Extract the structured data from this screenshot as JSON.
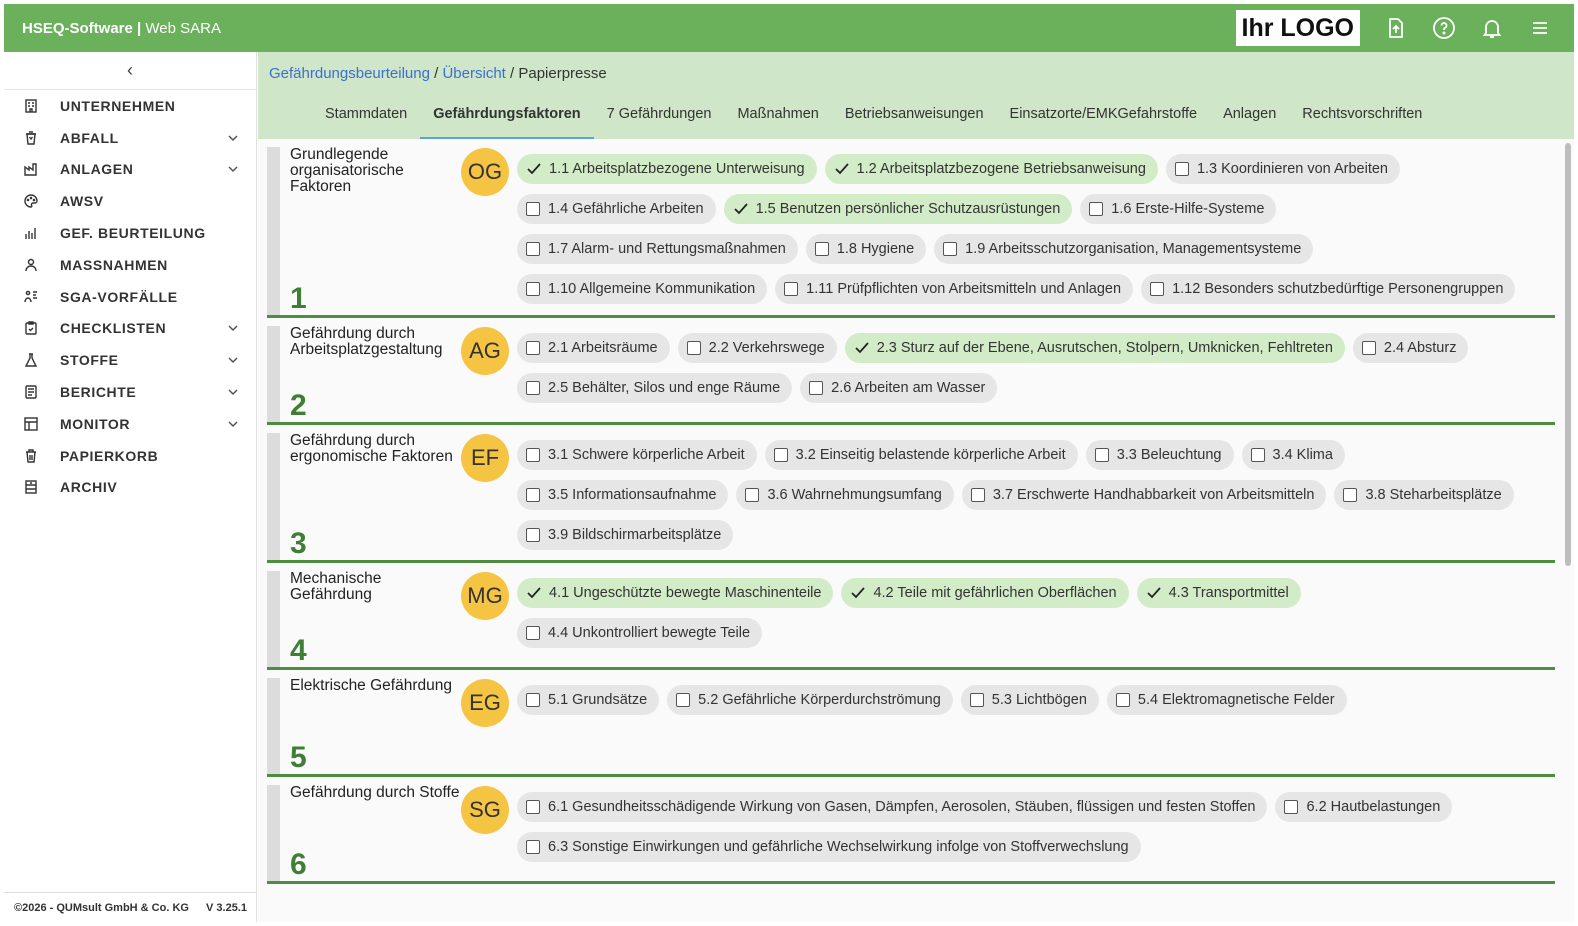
{
  "app": {
    "brand_bold": "HSEQ-Software |",
    "brand_light": " Web SARA",
    "logo_text": "Ihr LOGO"
  },
  "sidebar": {
    "collapse_icon": "chevron-left-icon",
    "items": [
      {
        "label": "UNTERNEHMEN",
        "icon": "building-icon",
        "expandable": false
      },
      {
        "label": "ABFALL",
        "icon": "recycle-icon",
        "expandable": true
      },
      {
        "label": "ANLAGEN",
        "icon": "factory-icon",
        "expandable": true
      },
      {
        "label": "AWSV",
        "icon": "palette-icon",
        "expandable": false
      },
      {
        "label": "GEF. BEURTEILUNG",
        "icon": "chart-icon",
        "expandable": false
      },
      {
        "label": "MASSNAHMEN",
        "icon": "people-icon",
        "expandable": false
      },
      {
        "label": "SGA-VORFÄLLE",
        "icon": "incident-icon",
        "expandable": false
      },
      {
        "label": "CHECKLISTEN",
        "icon": "clipboard-icon",
        "expandable": true
      },
      {
        "label": "STOFFE",
        "icon": "flask-icon",
        "expandable": true
      },
      {
        "label": "BERICHTE",
        "icon": "report-icon",
        "expandable": true
      },
      {
        "label": "MONITOR",
        "icon": "monitor-icon",
        "expandable": true
      },
      {
        "label": "PAPIERKORB",
        "icon": "trash-icon",
        "expandable": false
      },
      {
        "label": "ARCHIV",
        "icon": "archive-icon",
        "expandable": false
      }
    ],
    "footer_copyright": "©2026 - QUMsult GmbH & Co. KG",
    "footer_version": "V 3.25.1"
  },
  "breadcrumb": {
    "link1": "Gefährdungsbeurteilung",
    "sep": " / ",
    "link2": "Übersicht",
    "current": "Papierpresse"
  },
  "tabs": [
    "Stammdaten",
    "Gefährdungsfaktoren",
    "7 Gefährdungen",
    "Maßnahmen",
    "Betriebsanweisungen",
    "Einsatzorte/EMKGefahrstoffe",
    "Anlagen",
    "Rechtsvorschriften"
  ],
  "active_tab": "Gefährdungsfaktoren",
  "colors": {
    "accent_green": "#6bb15c",
    "subheader": "#cfe6c8",
    "badge": "#f5c443",
    "checked_chip": "#d2ecc8",
    "unchecked_chip": "#e6e6e6",
    "group_line": "#4e8c42"
  },
  "groups": [
    {
      "title": "Grundlegende organisatorische Faktoren",
      "badge": "OG",
      "number": "1",
      "items": [
        {
          "label": "1.1 Arbeitsplatzbezogene Unterweisung",
          "checked": true
        },
        {
          "label": "1.2 Arbeitsplatzbezogene Betriebsanweisung",
          "checked": true
        },
        {
          "label": "1.3 Koordinieren von Arbeiten",
          "checked": false
        },
        {
          "label": "1.4 Gefährliche Arbeiten",
          "checked": false
        },
        {
          "label": "1.5 Benutzen persönlicher Schutzausrüstungen",
          "checked": true
        },
        {
          "label": "1.6 Erste-Hilfe-Systeme",
          "checked": false
        },
        {
          "label": "1.7 Alarm- und Rettungsmaßnahmen",
          "checked": false
        },
        {
          "label": "1.8 Hygiene",
          "checked": false
        },
        {
          "label": "1.9 Arbeitsschutzorganisation, Managementsysteme",
          "checked": false
        },
        {
          "label": "1.10 Allgemeine Kommunikation",
          "checked": false
        },
        {
          "label": "1.11 Prüfpflichten von Arbeitsmitteln und Anlagen",
          "checked": false
        },
        {
          "label": "1.12 Besonders schutzbedürftige Personengruppen",
          "checked": false
        }
      ]
    },
    {
      "title": "Gefährdung durch Arbeitsplatzgestaltung",
      "badge": "AG",
      "number": "2",
      "items": [
        {
          "label": "2.1 Arbeitsräume",
          "checked": false
        },
        {
          "label": "2.2 Verkehrswege",
          "checked": false
        },
        {
          "label": "2.3 Sturz auf der Ebene, Ausrutschen, Stolpern, Umknicken, Fehltreten",
          "checked": true
        },
        {
          "label": "2.4 Absturz",
          "checked": false
        },
        {
          "label": "2.5 Behälter, Silos und enge Räume",
          "checked": false
        },
        {
          "label": "2.6 Arbeiten am Wasser",
          "checked": false
        }
      ]
    },
    {
      "title": "Gefährdung durch ergonomische Faktoren",
      "badge": "EF",
      "number": "3",
      "items": [
        {
          "label": "3.1 Schwere körperliche Arbeit",
          "checked": false
        },
        {
          "label": "3.2 Einseitig belastende körperliche Arbeit",
          "checked": false
        },
        {
          "label": "3.3 Beleuchtung",
          "checked": false
        },
        {
          "label": "3.4 Klima",
          "checked": false
        },
        {
          "label": "3.5 Informationsaufnahme",
          "checked": false
        },
        {
          "label": "3.6 Wahrnehmungsumfang",
          "checked": false
        },
        {
          "label": "3.7 Erschwerte Handhabbarkeit von Arbeitsmitteln",
          "checked": false
        },
        {
          "label": "3.8 Steharbeitsplätze",
          "checked": false
        },
        {
          "label": "3.9 Bildschirmarbeitsplätze",
          "checked": false
        }
      ]
    },
    {
      "title": "Mechanische Gefährdung",
      "badge": "MG",
      "number": "4",
      "items": [
        {
          "label": "4.1 Ungeschützte bewegte Maschinenteile",
          "checked": true
        },
        {
          "label": "4.2 Teile mit gefährlichen Oberflächen",
          "checked": true
        },
        {
          "label": "4.3 Transportmittel",
          "checked": true
        },
        {
          "label": "4.4 Unkontrolliert bewegte Teile",
          "checked": false
        }
      ]
    },
    {
      "title": "Elektrische Gefährdung",
      "badge": "EG",
      "number": "5",
      "items": [
        {
          "label": "5.1 Grundsätze",
          "checked": false
        },
        {
          "label": "5.2 Gefährliche Körperdurchströmung",
          "checked": false
        },
        {
          "label": "5.3 Lichtbögen",
          "checked": false
        },
        {
          "label": "5.4 Elektromagnetische Felder",
          "checked": false
        }
      ]
    },
    {
      "title": "Gefährdung durch Stoffe",
      "badge": "SG",
      "number": "6",
      "items": [
        {
          "label": "6.1 Gesundheitsschädigende Wirkung von Gasen, Dämpfen, Aerosolen, Stäuben, flüssigen und festen Stoffen",
          "checked": false
        },
        {
          "label": "6.2 Hautbelastungen",
          "checked": false
        },
        {
          "label": "6.3 Sonstige Einwirkungen und gefährliche Wechselwirkung infolge von Stoffverwechslung",
          "checked": false
        }
      ]
    }
  ]
}
